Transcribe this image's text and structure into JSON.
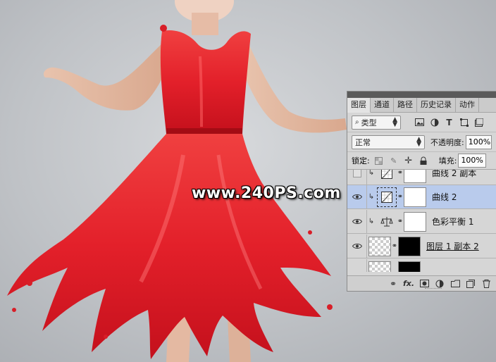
{
  "watermark": "www.240PS.com",
  "layers_panel": {
    "tabs": [
      "图层",
      "通道",
      "路径",
      "历史记录",
      "动作"
    ],
    "active_tab": 0,
    "filter": {
      "label": "类型"
    },
    "blend_mode": "正常",
    "opacity": {
      "label": "不透明度:",
      "value": "100%"
    },
    "lock": {
      "label": "锁定:"
    },
    "fill": {
      "label": "填充:",
      "value": "100%"
    },
    "layers": [
      {
        "name": "曲线 2 副本",
        "visible": false,
        "clipped": true,
        "icon": "curves-icon",
        "mask": "white",
        "selected": false
      },
      {
        "name": "曲线 2",
        "visible": true,
        "clipped": true,
        "icon": "curves-icon",
        "mask": "white",
        "selected": true
      },
      {
        "name": "色彩平衡 1",
        "visible": true,
        "clipped": true,
        "icon": "color-balance-icon",
        "mask": "white",
        "selected": false
      },
      {
        "name": "图层 1 副本 2",
        "visible": true,
        "clipped": false,
        "icon": "pixel-layer-thumbnail",
        "mask": "black",
        "selected": false
      }
    ]
  },
  "colors": {
    "selection": "#b9cbec",
    "dress": "#e3202a"
  }
}
